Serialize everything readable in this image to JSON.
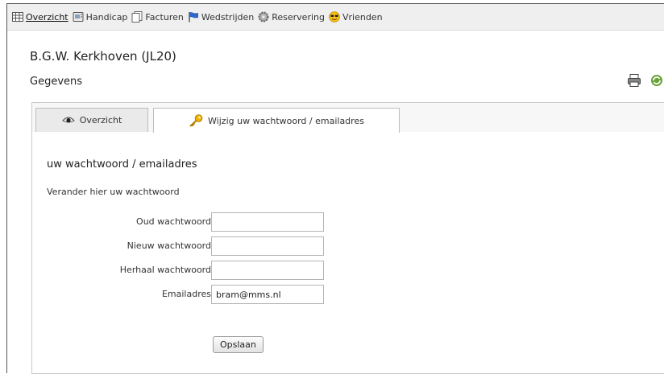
{
  "nav": {
    "items": [
      {
        "label": "Overzicht",
        "icon": "grid-icon",
        "active": true
      },
      {
        "label": "Handicap",
        "icon": "card-icon",
        "active": false
      },
      {
        "label": "Facturen",
        "icon": "documents-icon",
        "active": false
      },
      {
        "label": "Wedstrijden",
        "icon": "flag-icon",
        "active": false
      },
      {
        "label": "Reservering",
        "icon": "gear-icon",
        "active": false
      },
      {
        "label": "Vrienden",
        "icon": "sunglasses-smiley-icon",
        "active": false
      }
    ]
  },
  "header": {
    "title": "B.G.W. Kerkhoven (JL20)",
    "section": "Gegevens",
    "tools": [
      "printer-icon",
      "refresh-icon"
    ]
  },
  "tabs": [
    {
      "label": "Overzicht",
      "icon": "eye-icon",
      "active": false
    },
    {
      "label": "Wijzig uw wachtwoord / emailadres",
      "icon": "key-icon",
      "active": true
    }
  ],
  "form": {
    "title": "uw wachtwoord / emailadres",
    "subtitle": "Verander hier uw wachtwoord",
    "fields": [
      {
        "label": "Oud wachtwoord",
        "value": ""
      },
      {
        "label": "Nieuw wachtwoord",
        "value": ""
      },
      {
        "label": "Herhaal wachtwoord",
        "value": ""
      },
      {
        "label": "Emailadres",
        "value": "bram@mms.nl"
      }
    ],
    "save_label": "Opslaan"
  },
  "colors": {
    "nav_background": "#efefef",
    "panel_background": "#f7f7f7",
    "key_icon": "#f0b400",
    "flag_icon": "#2f66c8",
    "refresh_icon": "#6aa23a"
  }
}
